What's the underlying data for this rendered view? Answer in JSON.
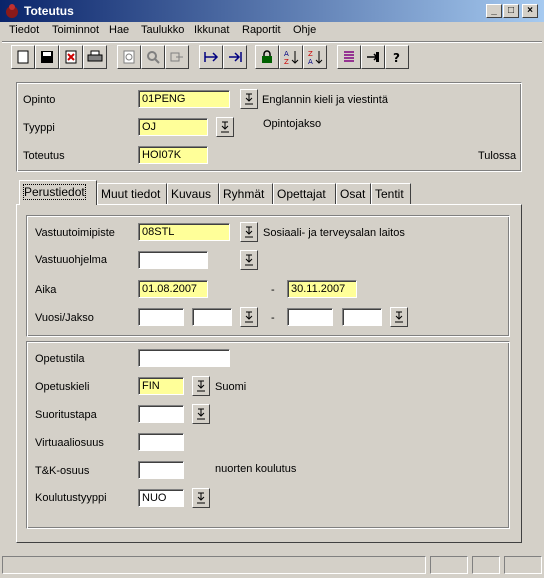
{
  "window": {
    "title": "Toteutus"
  },
  "menu": [
    "Tiedot",
    "Toiminnot",
    "Hae",
    "Taulukko",
    "Ikkunat",
    "Raportit",
    "Ohje"
  ],
  "toolbar": {
    "icons": [
      "new-icon",
      "save-icon",
      "delete-icon",
      "print-icon",
      "preview-icon",
      "find-icon",
      "export-icon",
      "move-in-icon",
      "move-out-icon",
      "lock-icon",
      "sort-asc-icon",
      "sort-desc-icon",
      "list-icon",
      "exit-icon",
      "help-icon"
    ]
  },
  "header": {
    "opinto_label": "Opinto",
    "opinto_value": "01PENG",
    "opinto_desc": "Englannin kieli ja viestintä",
    "tyyppi_label": "Tyyppi",
    "tyyppi_value": "OJ",
    "tyyppi_desc": "Opintojakso",
    "toteutus_label": "Toteutus",
    "toteutus_value": "HOI07K",
    "status": "Tulossa"
  },
  "tabs": [
    "Perustiedot",
    "Muut tiedot",
    "Kuvaus",
    "Ryhmät",
    "Opettajat",
    "Osat",
    "Tentit"
  ],
  "basic": {
    "vastuutoimipiste_label": "Vastuutoimipiste",
    "vastuutoimipiste_value": "08STL",
    "vastuutoimipiste_desc": "Sosiaali- ja terveysalan laitos",
    "vastuuohjelma_label": "Vastuuohjelma",
    "vastuuohjelma_value": "",
    "aika_label": "Aika",
    "aika_start": "01.08.2007",
    "aika_sep": "-",
    "aika_end": "30.11.2007",
    "vuosi_label": "Vuosi/Jakso",
    "vuosi_sep": "-"
  },
  "teaching": {
    "opetustila_label": "Opetustila",
    "opetustila_value": "",
    "opetuskieli_label": "Opetuskieli",
    "opetuskieli_value": "FIN",
    "opetuskieli_desc": "Suomi",
    "suoritustapa_label": "Suoritustapa",
    "suoritustapa_value": "",
    "virtuaaliosuus_label": "Virtuaaliosuus",
    "virtuaaliosuus_value": "",
    "tk_label": "T&K-osuus",
    "tk_value": "",
    "tk_desc": "nuorten koulutus",
    "koulutustyyppi_label": "Koulutustyyppi",
    "koulutustyyppi_value": "NUO"
  }
}
